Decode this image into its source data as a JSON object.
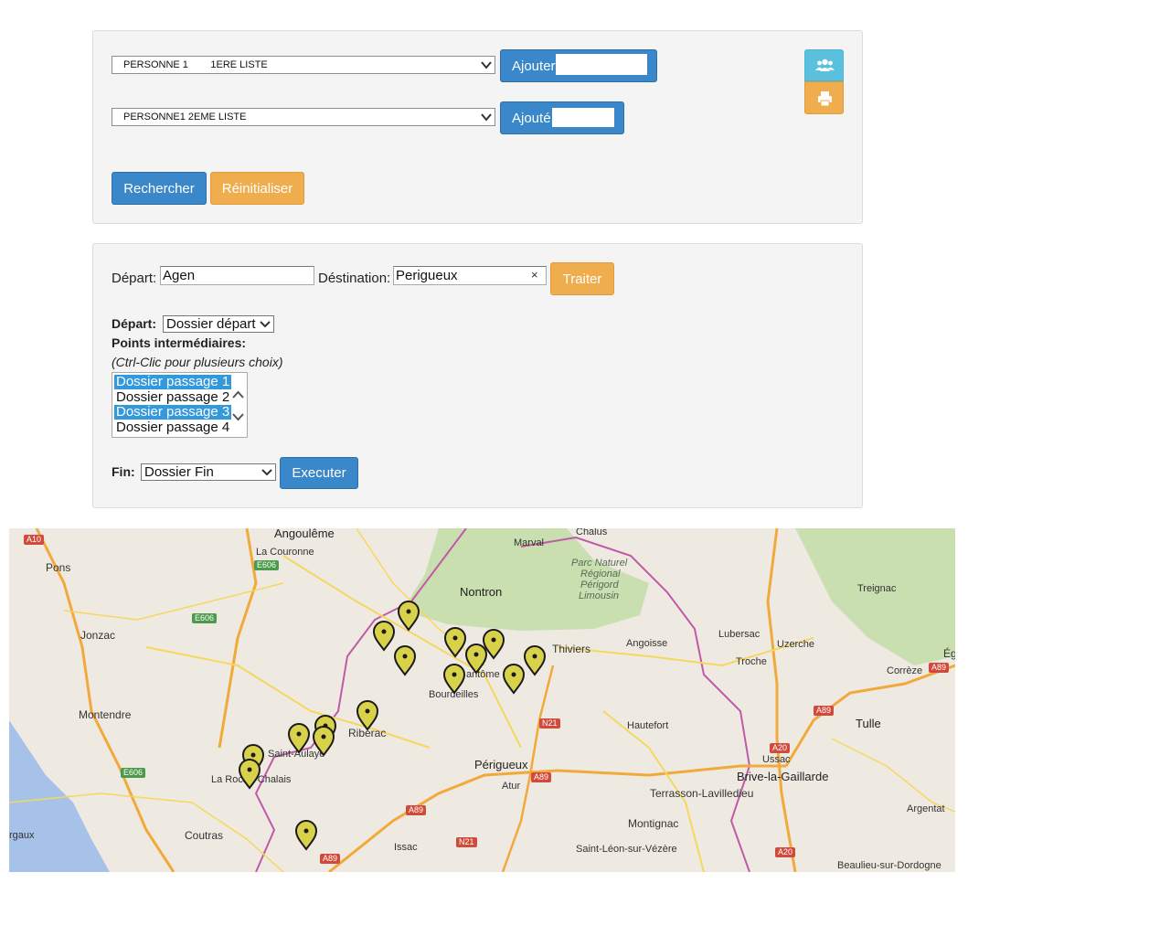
{
  "search_panel": {
    "list1": {
      "selected": "PERSONNE 1        1ERE LISTE"
    },
    "list2": {
      "selected": "PERSONNE1 2EME LISTE"
    },
    "add_button_label": "Ajouter",
    "added_button_label": "Ajouté",
    "group_icon": "users-icon",
    "print_icon": "print-icon",
    "search_button_label": "Rechercher",
    "reset_button_label": "Réinitialiser"
  },
  "route_panel": {
    "depart_label": "Départ:",
    "depart_value": "Agen",
    "destination_label": "Déstination:",
    "destination_value": "Perigueux",
    "clear_icon": "×",
    "process_button_label": "Traiter",
    "start_label": "Départ:",
    "start_select": "Dossier départ",
    "waypoints_label": "Points intermédiaires:",
    "waypoints_hint": "(Ctrl-Clic pour plusieurs choix)",
    "waypoints": [
      {
        "label": "Dossier passage 1",
        "selected": true
      },
      {
        "label": "Dossier passage 2",
        "selected": false
      },
      {
        "label": "Dossier passage 3",
        "selected": true
      },
      {
        "label": "Dossier passage 4",
        "selected": false
      }
    ],
    "end_label": "Fin:",
    "end_select": "Dossier Fin",
    "execute_button_label": "Executer"
  },
  "map": {
    "places": {
      "angouleme": "Angoulême",
      "la_couronne": "La Couronne",
      "chalus": "Chalus",
      "marval": "Marval",
      "pons": "Pons",
      "nontron": "Nontron",
      "parc1": "Parc Naturel",
      "parc2": "Régional",
      "parc3": "Périgord",
      "parc4": "Limousin",
      "treignac": "Treignac",
      "jonzac": "Jonzac",
      "thiviers": "Thiviers",
      "angoisse": "Angoisse",
      "lubersac": "Lubersac",
      "uzerche": "Uzerche",
      "troche": "Troche",
      "correze": "Corrèze",
      "eg": "Ég",
      "brantome": "antôme",
      "bourdeilles": "Bourdeilles",
      "montendre": "Montendre",
      "riberac": "Riberac",
      "hautefort": "Hautefort",
      "tulle": "Tulle",
      "saint_aulaye": "Saint-Aulaye",
      "ussac": "Ussac",
      "perigueux": "Périgueux",
      "la_roche": "La Roche-Chalais",
      "atur": "Atur",
      "brive": "Brive-la-Gaillarde",
      "terrasson": "Terrasson-Lavilledieu",
      "argentat": "Argentat",
      "coutras": "Coutras",
      "montignac": "Montignac",
      "bordeaux": "rgaux",
      "issac": "Issac",
      "saint_leon": "Saint-Léon-sur-Vézère",
      "beaulieu": "Beaulieu-sur-Dordogne"
    },
    "roads": {
      "a10": "A10",
      "e606a": "E606",
      "e606b": "E606",
      "e606c": "E606",
      "a89a": "A89",
      "a89b": "A89",
      "a89c": "A89",
      "a89d": "A89",
      "a89e": "A89",
      "n21a": "N21",
      "n21b": "N21",
      "a20a": "A20",
      "a20b": "A20"
    },
    "marker_icon": "map-marker-icon"
  }
}
